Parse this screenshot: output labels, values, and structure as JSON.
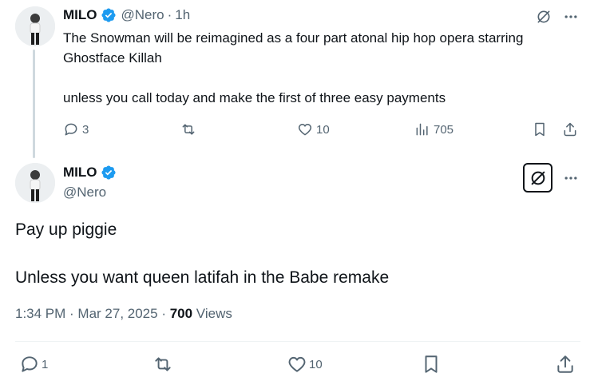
{
  "reply": {
    "author_name": "MILO",
    "handle": "@Nero",
    "separator": "·",
    "time_ago": "1h",
    "lines": [
      "The Snowman will be reimagined as a four  part atonal hip hop opera starring Ghostface Killah",
      "unless you call today and make the first of three easy payments"
    ],
    "stats": {
      "replies": "3",
      "likes": "10",
      "views": "705"
    }
  },
  "main": {
    "author_name": "MILO",
    "handle": "@Nero",
    "lines": [
      "Pay up piggie",
      "Unless you want queen latifah in the Babe remake"
    ],
    "timestamp": "1:34 PM · Mar 27, 2025 · ",
    "views_count": "700",
    "views_label": " Views",
    "stats": {
      "replies": "1",
      "likes": "10"
    }
  },
  "colors": {
    "verified": "#1d9bf0",
    "text": "#0f1419",
    "muted": "#536471"
  },
  "icons": [
    "verified-badge-icon",
    "grok-icon",
    "more-icon",
    "reply-icon",
    "retweet-icon",
    "like-icon",
    "views-icon",
    "bookmark-icon",
    "share-icon"
  ]
}
